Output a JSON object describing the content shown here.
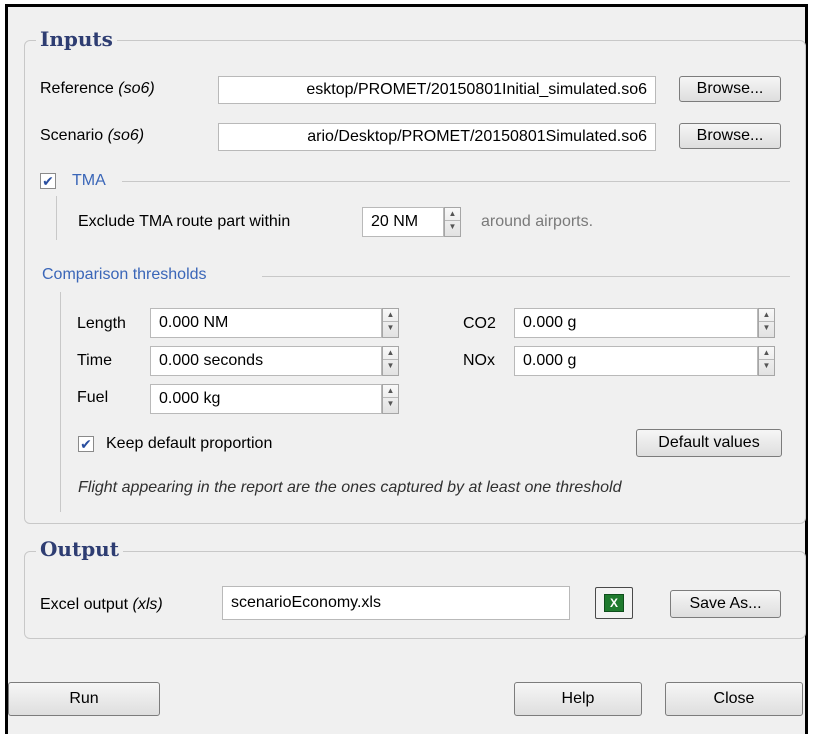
{
  "inputs": {
    "group_title": "Inputs",
    "reference": {
      "label": "Reference",
      "hint": "(so6)",
      "value": "esktop/PROMET/20150801Initial_simulated.so6",
      "browse_label": "Browse..."
    },
    "scenario": {
      "label": "Scenario",
      "hint": "(so6)",
      "value": "ario/Desktop/PROMET/20150801Simulated.so6",
      "browse_label": "Browse..."
    },
    "tma": {
      "title": "TMA",
      "checked_mark": "✔",
      "exclude_label": "Exclude TMA route part within",
      "exclude_value": "20 NM",
      "suffix": "around airports."
    },
    "thresholds": {
      "title": "Comparison thresholds",
      "length": {
        "label": "Length",
        "value": "0.000 NM"
      },
      "time": {
        "label": "Time",
        "value": "0.000 seconds"
      },
      "fuel": {
        "label": "Fuel",
        "value": "0.000 kg"
      },
      "co2": {
        "label": "CO2",
        "value": "0.000 g"
      },
      "nox": {
        "label": "NOx",
        "value": "0.000 g"
      },
      "keep_default_label": "Keep default proportion",
      "keep_default_mark": "✔",
      "default_values_label": "Default values",
      "note": "Flight appearing in the report are the ones captured by at least one threshold"
    }
  },
  "output": {
    "group_title": "Output",
    "excel_label": "Excel output",
    "excel_hint": "(xls)",
    "excel_value": "scenarioEconomy.xls",
    "excel_icon_glyph": "X",
    "save_as_label": "Save As..."
  },
  "footer": {
    "run_label": "Run",
    "help_label": "Help",
    "close_label": "Close"
  },
  "colors": {
    "group_title": "#2e3d72",
    "sub_title": "#3a66b8",
    "excel_green": "#1f7a2e"
  },
  "icons": {
    "spin_up": "▲",
    "spin_down": "▼",
    "excel": "excel-icon"
  }
}
